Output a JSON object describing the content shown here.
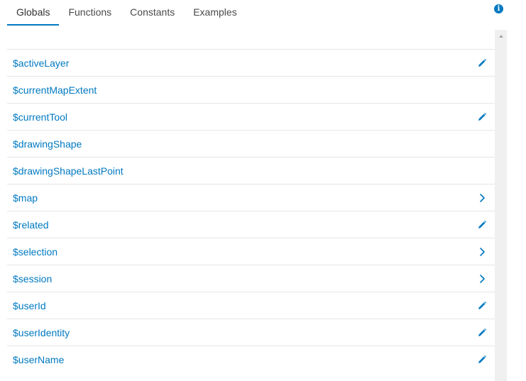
{
  "tabs": [
    {
      "label": "Globals",
      "active": true
    },
    {
      "label": "Functions",
      "active": false
    },
    {
      "label": "Constants",
      "active": false
    },
    {
      "label": "Examples",
      "active": false
    }
  ],
  "info_icon": "info-icon",
  "accent_color": "#0079c1",
  "items": [
    {
      "label": "$activeLayer",
      "icon": "pencil-icon"
    },
    {
      "label": "$currentMapExtent",
      "icon": ""
    },
    {
      "label": "$currentTool",
      "icon": "pencil-icon"
    },
    {
      "label": "$drawingShape",
      "icon": ""
    },
    {
      "label": "$drawingShapeLastPoint",
      "icon": ""
    },
    {
      "label": "$map",
      "icon": "chevron-right-icon"
    },
    {
      "label": "$related",
      "icon": "pencil-icon"
    },
    {
      "label": "$selection",
      "icon": "chevron-right-icon"
    },
    {
      "label": "$session",
      "icon": "chevron-right-icon"
    },
    {
      "label": "$userId",
      "icon": "pencil-icon"
    },
    {
      "label": "$userIdentity",
      "icon": "pencil-icon"
    },
    {
      "label": "$userName",
      "icon": "pencil-icon"
    }
  ]
}
